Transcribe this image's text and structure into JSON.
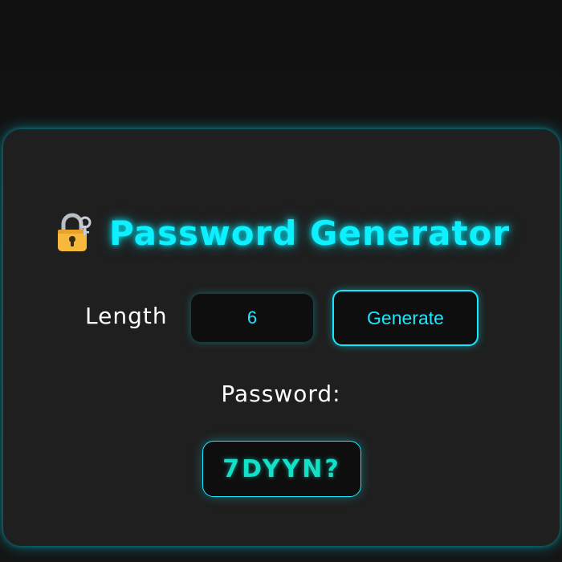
{
  "header": {
    "title": "Password Generator",
    "icon": "lock-with-key-icon"
  },
  "controls": {
    "length_label": "Length",
    "length_value": "6",
    "generate_label": "Generate"
  },
  "output": {
    "label": "Password:",
    "value": "7DYYN?"
  },
  "colors": {
    "accent": "#0ff0ff",
    "password_text": "#13e0c8",
    "card_bg": "#1f1f1f",
    "page_bg": "#131313"
  }
}
